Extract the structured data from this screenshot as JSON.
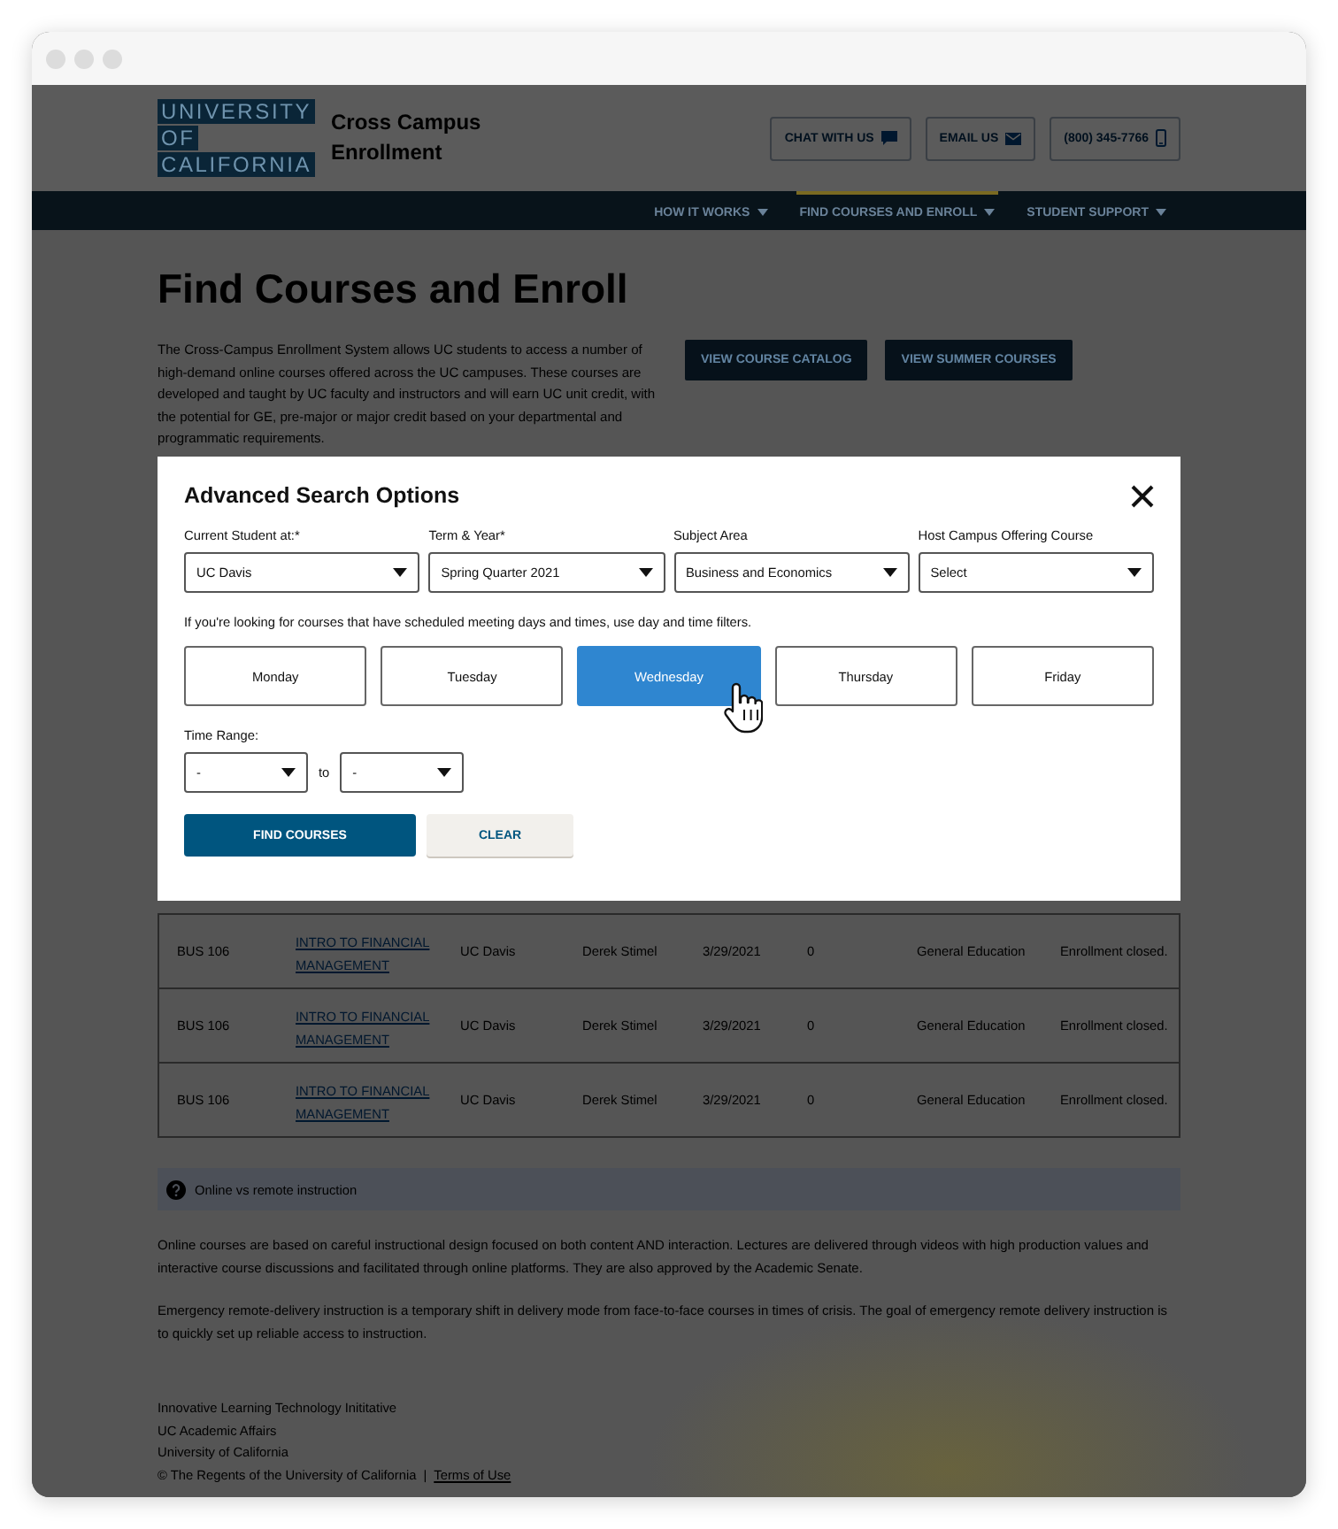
{
  "header": {
    "logo": [
      "UNIVERSITY",
      "OF",
      "CALIFORNIA"
    ],
    "site_title": "Cross Campus Enrollment",
    "contact_buttons": [
      {
        "label": "CHAT WITH US",
        "kind": "chat"
      },
      {
        "label": "EMAIL US",
        "kind": "email"
      },
      {
        "label": "(800) 345-7766",
        "kind": "phone"
      }
    ]
  },
  "nav": [
    {
      "label": "HOW IT WORKS",
      "selected": false
    },
    {
      "label": "FIND COURSES AND ENROLL",
      "selected": true
    },
    {
      "label": "STUDENT SUPPORT",
      "selected": false
    }
  ],
  "page": {
    "title": "Find Courses and Enroll",
    "intro": "The Cross-Campus Enrollment System allows UC students to access a number of high-demand online courses offered across the UC campuses. These courses are developed and taught by UC faculty and instructors and will earn UC unit credit, with the potential for GE, pre-major or major credit based on your departmental and programmatic requirements.",
    "buttons": [
      "VIEW COURSE CATALOG",
      "VIEW SUMMER COURSES"
    ]
  },
  "modal": {
    "title": "Advanced Search Options",
    "fields": [
      {
        "label": "Current Student at:*",
        "value": "UC Davis"
      },
      {
        "label": "Term & Year*",
        "value": "Spring Quarter 2021"
      },
      {
        "label": "Subject Area",
        "value": "Business and Economics"
      },
      {
        "label": "Host Campus Offering Course",
        "value": "Select"
      }
    ],
    "hint": "If you're looking for courses that have scheduled meeting days and times, use day and time filters.",
    "days": [
      {
        "label": "Monday",
        "selected": false
      },
      {
        "label": "Tuesday",
        "selected": false
      },
      {
        "label": "Wednesday",
        "selected": true
      },
      {
        "label": "Thursday",
        "selected": false
      },
      {
        "label": "Friday",
        "selected": false
      }
    ],
    "time_range": {
      "label": "Time Range:",
      "from": "-",
      "separator": "to",
      "to": "-"
    },
    "buttons": [
      {
        "label": "FIND COURSES",
        "kind": "primary"
      },
      {
        "label": "CLEAR",
        "kind": "secondary"
      }
    ]
  },
  "table": {
    "rows": [
      [
        "BUS 106",
        "INTRO TO FINANCIAL MANAGEMENT",
        "UC Davis",
        "Derek Stimel",
        "3/29/2021",
        "0",
        "General Education",
        "Enrollment closed."
      ],
      [
        "BUS 106",
        "INTRO TO FINANCIAL MANAGEMENT",
        "UC Davis",
        "Derek Stimel",
        "3/29/2021",
        "0",
        "General Education",
        "Enrollment closed."
      ],
      [
        "BUS 106",
        "INTRO TO FINANCIAL MANAGEMENT",
        "UC Davis",
        "Derek Stimel",
        "3/29/2021",
        "0",
        "General Education",
        "Enrollment closed."
      ]
    ]
  },
  "info_bar": {
    "label": "Online vs remote instruction"
  },
  "paragraphs": [
    "Online courses are based on careful instructional design focused on both content AND interaction. Lectures are delivered through videos with high production values and interactive course discussions and facilitated through online platforms. They are also approved by the Academic Senate.",
    "Emergency remote-delivery instruction is a temporary shift in delivery mode from face-to-face courses in times of crisis. The goal of emergency remote delivery instruction is to quickly set up reliable access to instruction."
  ],
  "footer": {
    "lines": [
      "Innovative Learning Technology Inititative",
      "UC Academic Affairs",
      "University of California"
    ],
    "copyright": "© The Regents of the University of California",
    "separator": "|",
    "link": "Terms of Use"
  }
}
